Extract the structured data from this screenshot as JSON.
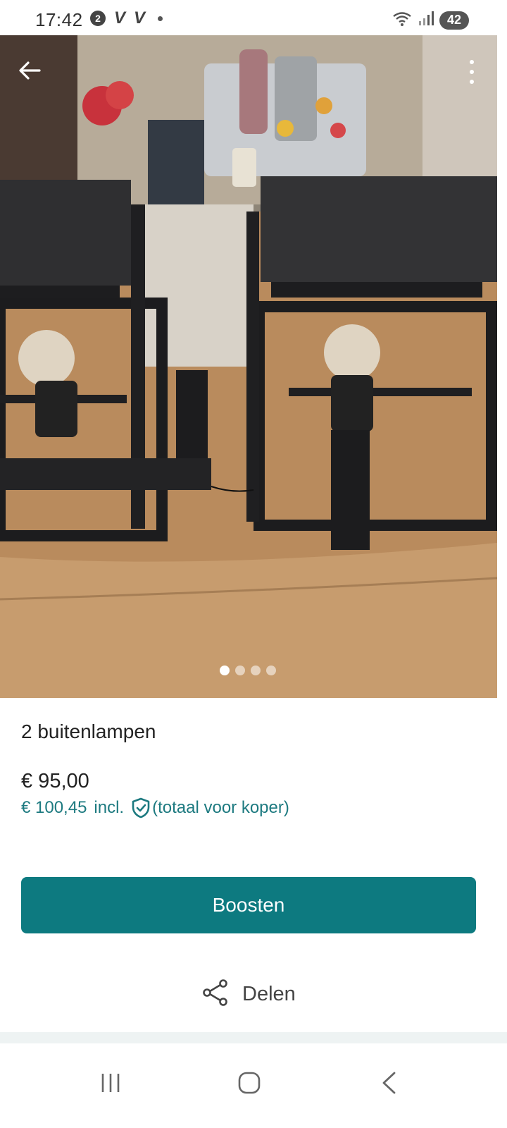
{
  "status_bar": {
    "time": "17:42",
    "notification_badge": "2",
    "app_glyph_1": "V",
    "app_glyph_2": "V",
    "battery": "42",
    "icons": [
      "wifi-icon",
      "signal-icon",
      "battery-icon"
    ]
  },
  "photo": {
    "page_count": 4,
    "active_page": 1,
    "icons": [
      "back-arrow-icon",
      "more-vert-icon"
    ]
  },
  "listing": {
    "title": "2 buitenlampen",
    "price": "€ 95,00",
    "price_incl_amount": "€ 100,45",
    "price_incl_label": "incl.",
    "price_incl_note": "(totaal voor koper)"
  },
  "actions": {
    "boost_label": "Boosten",
    "share_label": "Delen"
  },
  "colors": {
    "accent": "#0d7a80",
    "price_incl": "#1d7a80"
  },
  "navbar": {
    "icons": [
      "recents-icon",
      "home-icon",
      "back-icon"
    ]
  }
}
